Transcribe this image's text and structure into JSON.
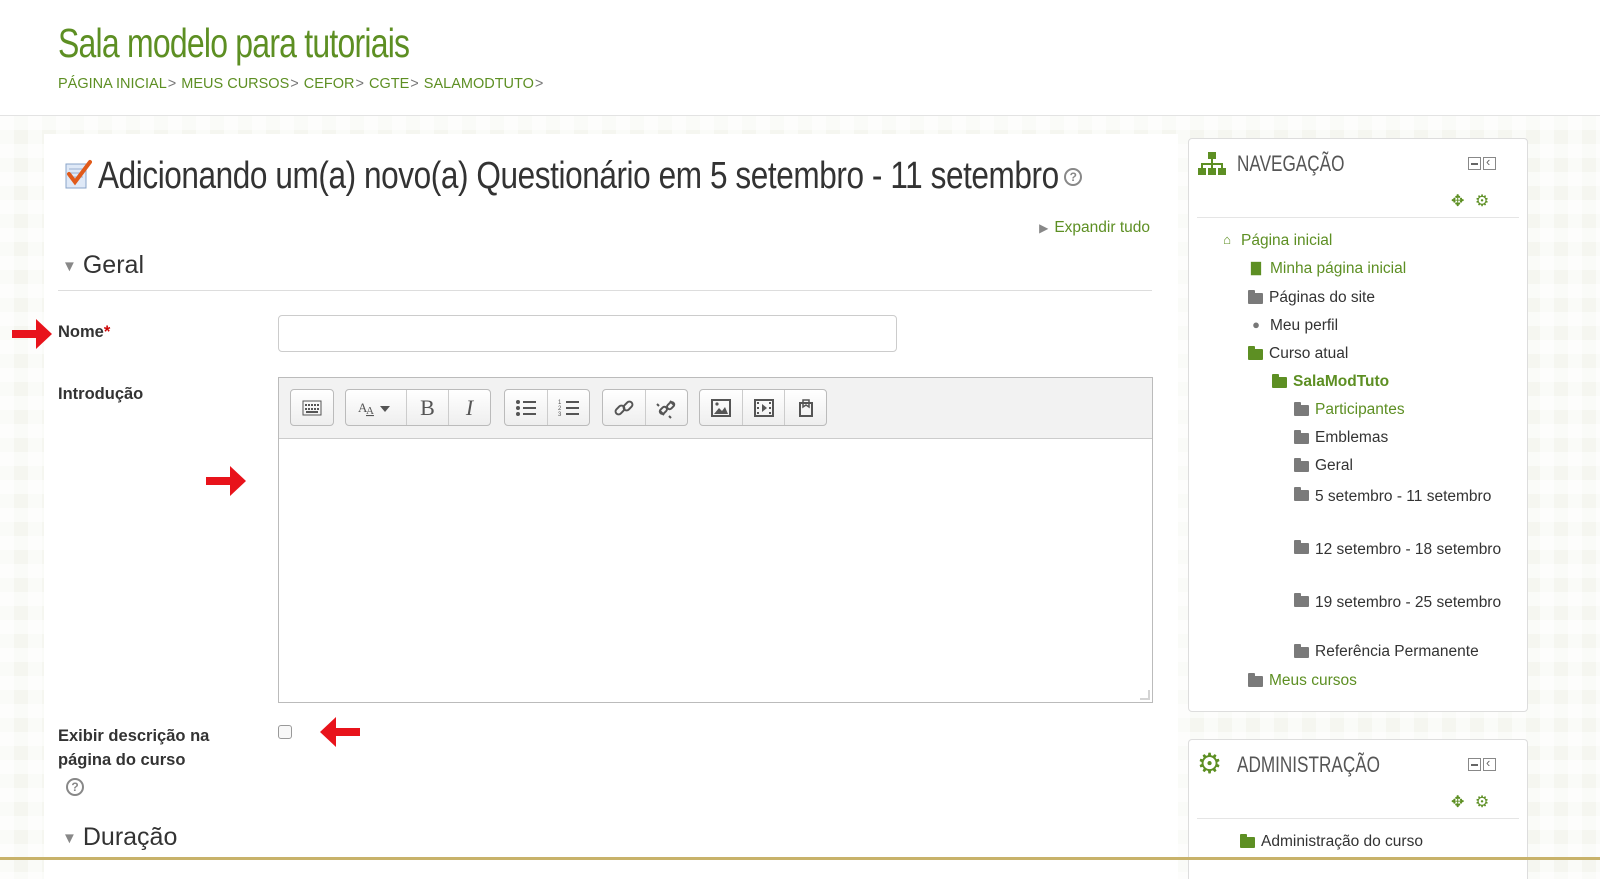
{
  "header": {
    "site_title": "Sala modelo para tutoriais",
    "breadcrumb": [
      "Página inicial",
      "Meus cursos",
      "CEFOR",
      "CGTE",
      "SALAMODTUTO"
    ],
    "separator": ">"
  },
  "main": {
    "page_title": "Adicionando um(a) novo(a) Questionário em 5 setembro - 11 setembro",
    "expand_all": "Expandir tudo",
    "section_general": "Geral",
    "section_duration": "Duração",
    "field_name_label": "Nome",
    "required_mark": "*",
    "field_name_value": "",
    "field_intro_label": "Introdução",
    "field_show_desc_label": "Exibir descrição na página do curso",
    "show_desc_checked": false,
    "help_glyph": "?"
  },
  "editor_toolbar": {
    "icons": [
      "show-more-icon",
      "font-style-icon",
      "bold-icon",
      "italic-icon",
      "unordered-list-icon",
      "ordered-list-icon",
      "link-icon",
      "unlink-icon",
      "image-icon",
      "media-icon",
      "manage-files-icon"
    ],
    "bold_glyph": "B",
    "italic_glyph": "I"
  },
  "nav_block": {
    "title": "NAVEGAÇÃO",
    "items": [
      {
        "label": "Página inicial",
        "type": "link"
      },
      {
        "label": "Minha página inicial",
        "type": "link"
      },
      {
        "label": "Páginas do site",
        "type": "plain"
      },
      {
        "label": "Meu perfil",
        "type": "plain"
      },
      {
        "label": "Curso atual",
        "type": "plain"
      },
      {
        "label": "SalaModTuto",
        "type": "bold"
      },
      {
        "label": "Participantes",
        "type": "link"
      },
      {
        "label": "Emblemas",
        "type": "plain"
      },
      {
        "label": "Geral",
        "type": "plain"
      },
      {
        "label": "5 setembro - 11 setembro",
        "type": "plain"
      },
      {
        "label": "12 setembro - 18 setembro",
        "type": "plain"
      },
      {
        "label": "19 setembro - 25 setembro",
        "type": "plain"
      },
      {
        "label": "Referência Permanente",
        "type": "plain"
      },
      {
        "label": "Meus cursos",
        "type": "link"
      }
    ]
  },
  "admin_block": {
    "title": "ADMINISTRAÇÃO",
    "items": [
      {
        "label": "Administração do curso",
        "type": "plain"
      }
    ]
  },
  "colors": {
    "accent": "#5d8f23",
    "annotation_arrow": "#e8131b"
  }
}
